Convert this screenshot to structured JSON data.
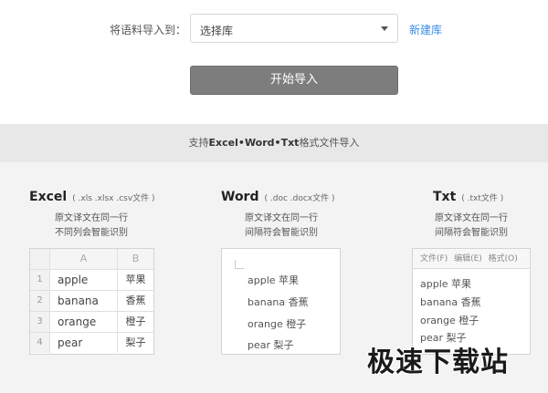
{
  "import": {
    "label": "将语料导入到：",
    "select_value": "选择库",
    "new_lib": "新建库",
    "start_button": "开始导入"
  },
  "banner": {
    "prefix": "支持",
    "formats": "Excel•Word•Txt",
    "suffix": "格式文件导入"
  },
  "excel": {
    "title": "Excel",
    "ext": "( .xls .xlsx .csv文件 )",
    "desc1": "原文译文在同一行",
    "desc2": "不同列会智能识别",
    "col_a": "A",
    "col_b": "B",
    "rows": [
      {
        "n": "1",
        "a": "apple",
        "b": "苹果"
      },
      {
        "n": "2",
        "a": "banana",
        "b": "香蕉"
      },
      {
        "n": "3",
        "a": "orange",
        "b": "橙子"
      },
      {
        "n": "4",
        "a": "pear",
        "b": "梨子"
      }
    ]
  },
  "word": {
    "title": "Word",
    "ext": "( .doc .docx文件 )",
    "desc1": "原文译文在同一行",
    "desc2": "间隔符会智能识别",
    "lines": [
      "apple 苹果",
      "banana 香蕉",
      "orange 橙子",
      "pear 梨子"
    ]
  },
  "txt": {
    "title": "Txt",
    "ext": "( .txt文件 )",
    "desc1": "原文译文在同一行",
    "desc2": "间隔符会智能识别",
    "menu": [
      "文件(F)",
      "编辑(E)",
      "格式(O)"
    ],
    "lines": [
      "apple 苹果",
      "banana 香蕉",
      "orange 橙子",
      "pear 梨子"
    ]
  },
  "watermark": "极速下载站",
  "colors": {
    "link": "#3a8ee6",
    "button": "#7d7d7d",
    "banner_bg": "#e8e8e8",
    "panel_bg": "#f3f3f3"
  }
}
